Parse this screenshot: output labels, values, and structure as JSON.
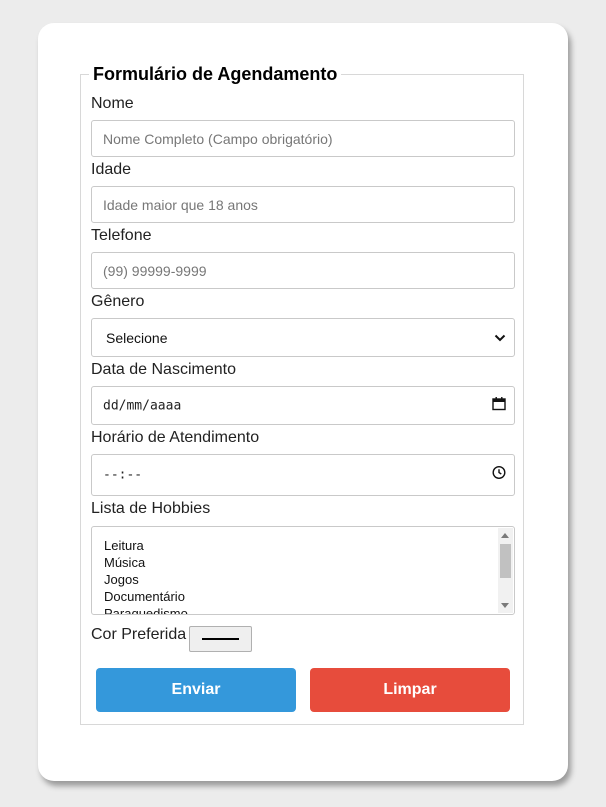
{
  "form": {
    "title": "Formulário de Agendamento",
    "nome": {
      "label": "Nome",
      "placeholder": "Nome Completo (Campo obrigatório)"
    },
    "idade": {
      "label": "Idade",
      "placeholder": "Idade maior que 18 anos"
    },
    "telefone": {
      "label": "Telefone",
      "placeholder": "(99) 99999-9999"
    },
    "genero": {
      "label": "Gênero",
      "selected": "Selecione"
    },
    "nascimento": {
      "label": "Data de Nascimento",
      "placeholder": "dd/mm/aaaa"
    },
    "horario": {
      "label": "Horário de Atendimento",
      "placeholder": "--:--"
    },
    "hobbies": {
      "label": "Lista de Hobbies",
      "options": [
        "Leitura",
        "Música",
        "Jogos",
        "Documentário",
        "Paraquedismo"
      ]
    },
    "cor": {
      "label": "Cor Preferida",
      "value": "#000000"
    },
    "buttons": {
      "send": "Enviar",
      "clear": "Limpar"
    }
  },
  "colors": {
    "send": "#3498db",
    "clear": "#e74c3c"
  },
  "icons": {
    "select": "chevron-down-icon",
    "date": "calendar-icon",
    "time": "clock-icon"
  }
}
